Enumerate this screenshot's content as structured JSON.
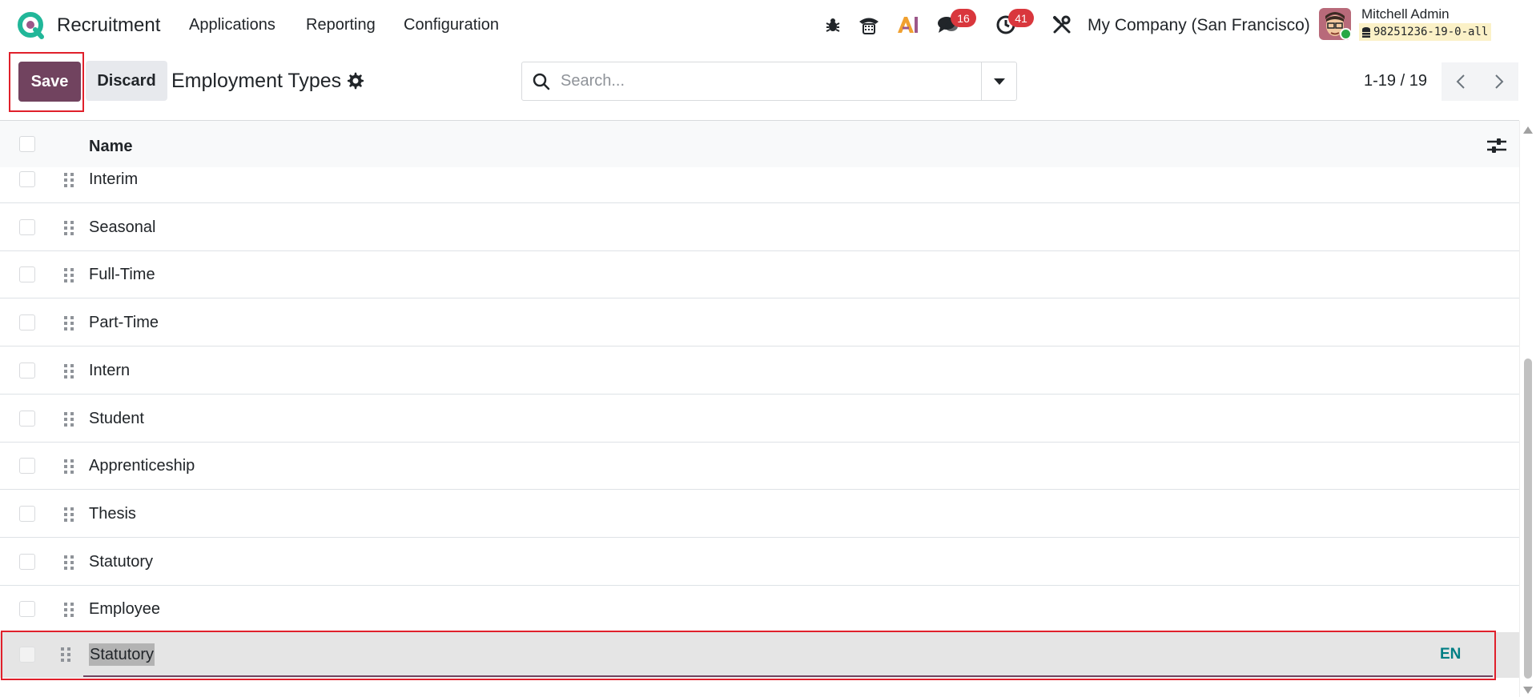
{
  "navbar": {
    "app_name": "Recruitment",
    "menu": [
      "Applications",
      "Reporting",
      "Configuration"
    ],
    "messages_count": "16",
    "activities_count": "41",
    "company": "My Company (San Francisco)",
    "user_name": "Mitchell Admin",
    "database": "98251236-19-0-all"
  },
  "control_panel": {
    "save_label": "Save",
    "discard_label": "Discard",
    "title": "Employment Types",
    "search_placeholder": "Search...",
    "pager_value": "1-19 / 19"
  },
  "list": {
    "column_name": "Name",
    "rows": [
      "Interim",
      "Seasonal",
      "Full-Time",
      "Part-Time",
      "Intern",
      "Student",
      "Apprenticeship",
      "Thesis",
      "Statutory",
      "Employee"
    ],
    "editing_row": {
      "value": "Statutory",
      "lang_label": "EN"
    }
  },
  "colors": {
    "primary": "#71435f",
    "badge": "#d9373d",
    "highlight": "#e0202b",
    "lang_link": "#017e84"
  },
  "icons": [
    "app-logo-icon",
    "bug-icon",
    "phone-icon",
    "ai-icon",
    "messages-icon",
    "activity-clock-icon",
    "tools-icon",
    "gear-icon",
    "search-icon",
    "caret-down-icon",
    "chevron-left-icon",
    "chevron-right-icon",
    "drag-handle-icon",
    "optional-columns-icon"
  ]
}
